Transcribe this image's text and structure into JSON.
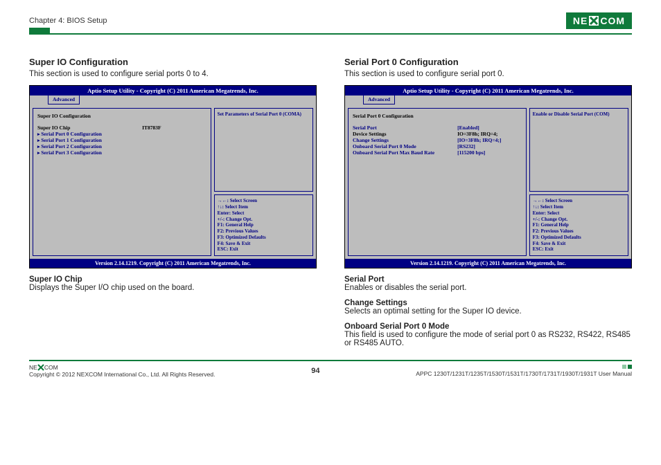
{
  "header": {
    "chapter": "Chapter 4: BIOS Setup",
    "brand": "NEXCOM"
  },
  "page_number": "94",
  "footer": {
    "copyright": "Copyright © 2012 NEXCOM International Co., Ltd. All Rights Reserved.",
    "manual": "APPC 1230T/1231T/1235T/1530T/1531T/1730T/1731T/1930T/1931T User Manual"
  },
  "bios_shared": {
    "utility_title": "Aptio Setup Utility - Copyright (C) 2011 American Megatrends, Inc.",
    "tab_label": "Advanced",
    "footer_text": "Version 2.14.1219. Copyright (C) 2011 American Megatrends, Inc.",
    "help_lines": [
      "→←: Select Screen",
      "↑↓: Select Item",
      "Enter: Select",
      "+/-: Change Opt.",
      "F1: General Help",
      "F2: Previous Values",
      "F3: Optimized Defaults",
      "F4: Save & Exit",
      "ESC: Exit"
    ]
  },
  "left": {
    "title": "Super IO Configuration",
    "subtitle": "This section is used to configure serial ports 0 to 4.",
    "panel_title": "Super IO Configuration",
    "chip_label": "Super IO Chip",
    "chip_value": "IT8783F",
    "menu": [
      "Serial Port 0 Configuration",
      "Serial Port 1 Configuration",
      "Serial Port 2 Configuration",
      "Serial Port 3 Configuration"
    ],
    "hint": "Set Parameters of Serial Port 0 (COMA)",
    "desc_title": "Super IO Chip",
    "desc_body": "Displays the Super I/O chip used on the board."
  },
  "right": {
    "title": "Serial Port 0 Configuration",
    "subtitle": "This section is used to configure serial port 0.",
    "panel_title": "Serial Port 0 Configuration",
    "rows": [
      {
        "label": "Serial Port",
        "value": "[Enabled]",
        "cls": "row-blue"
      },
      {
        "label": "Device Settings",
        "value": "IO=3F8h; IRQ=4;",
        "cls": "row-black"
      },
      {
        "label": "",
        "value": "",
        "cls": "row-black"
      },
      {
        "label": "Change Settings",
        "value": "[IO=3F8h; IRQ=4;]",
        "cls": "row-blue"
      },
      {
        "label": "Onboard Serial Port 0 Mode",
        "value": "[RS232]",
        "cls": "row-blue"
      },
      {
        "label": "Onboard Serial Port Max Baud Rate",
        "value": "[115200 bps]",
        "cls": "row-blue"
      }
    ],
    "hint": "Enable or Disable Serial Port (COM)",
    "descs": [
      {
        "t": "Serial Port",
        "b": "Enables or disables the serial port."
      },
      {
        "t": "Change Settings",
        "b": "Selects an optimal setting for the Super IO device."
      },
      {
        "t": "Onboard Serial Port 0 Mode",
        "b": "This field is used to configure the mode of serial port 0 as RS232, RS422, RS485 or RS485 AUTO."
      }
    ]
  }
}
